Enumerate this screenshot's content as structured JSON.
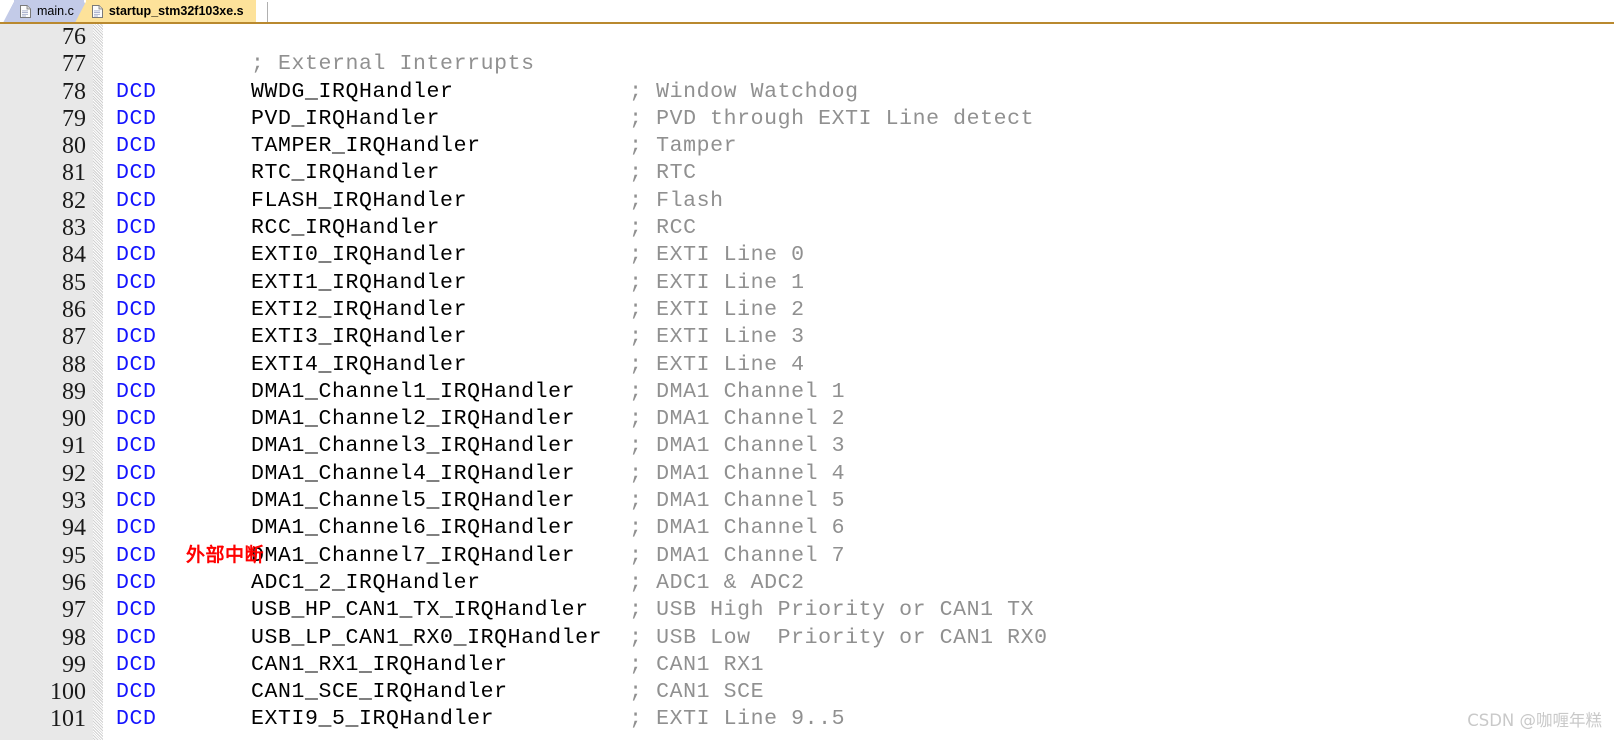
{
  "tabs": [
    {
      "label": "main.c",
      "active": false,
      "icon": "file-icon"
    },
    {
      "label": "startup_stm32f103xe.s",
      "active": true,
      "icon": "file-icon"
    }
  ],
  "editor": {
    "first_line_number": 76,
    "annotation": {
      "text": "外部中断",
      "color": "#ff0000",
      "near_line": 94
    },
    "colors": {
      "keyword": "#1414ff",
      "comment": "#909090",
      "text": "#000000",
      "gutter_background": "#e8e8e8",
      "active_tab": "#fde29a",
      "inactive_tab": "#c3cbe8"
    },
    "lines": [
      {
        "n": "76",
        "kw": "",
        "name": "",
        "cmt": ""
      },
      {
        "n": "77",
        "kw": "",
        "name": "",
        "cmt": "; External Interrupts"
      },
      {
        "n": "78",
        "kw": "DCD",
        "name": "WWDG_IRQHandler",
        "cmt": "; Window Watchdog"
      },
      {
        "n": "79",
        "kw": "DCD",
        "name": "PVD_IRQHandler",
        "cmt": "; PVD through EXTI Line detect"
      },
      {
        "n": "80",
        "kw": "DCD",
        "name": "TAMPER_IRQHandler",
        "cmt": "; Tamper"
      },
      {
        "n": "81",
        "kw": "DCD",
        "name": "RTC_IRQHandler",
        "cmt": "; RTC"
      },
      {
        "n": "82",
        "kw": "DCD",
        "name": "FLASH_IRQHandler",
        "cmt": "; Flash"
      },
      {
        "n": "83",
        "kw": "DCD",
        "name": "RCC_IRQHandler",
        "cmt": "; RCC"
      },
      {
        "n": "84",
        "kw": "DCD",
        "name": "EXTI0_IRQHandler",
        "cmt": "; EXTI Line 0"
      },
      {
        "n": "85",
        "kw": "DCD",
        "name": "EXTI1_IRQHandler",
        "cmt": "; EXTI Line 1"
      },
      {
        "n": "86",
        "kw": "DCD",
        "name": "EXTI2_IRQHandler",
        "cmt": "; EXTI Line 2"
      },
      {
        "n": "87",
        "kw": "DCD",
        "name": "EXTI3_IRQHandler",
        "cmt": "; EXTI Line 3"
      },
      {
        "n": "88",
        "kw": "DCD",
        "name": "EXTI4_IRQHandler",
        "cmt": "; EXTI Line 4"
      },
      {
        "n": "89",
        "kw": "DCD",
        "name": "DMA1_Channel1_IRQHandler",
        "cmt": "; DMA1 Channel 1"
      },
      {
        "n": "90",
        "kw": "DCD",
        "name": "DMA1_Channel2_IRQHandler",
        "cmt": "; DMA1 Channel 2"
      },
      {
        "n": "91",
        "kw": "DCD",
        "name": "DMA1_Channel3_IRQHandler",
        "cmt": "; DMA1 Channel 3"
      },
      {
        "n": "92",
        "kw": "DCD",
        "name": "DMA1_Channel4_IRQHandler",
        "cmt": "; DMA1 Channel 4"
      },
      {
        "n": "93",
        "kw": "DCD",
        "name": "DMA1_Channel5_IRQHandler",
        "cmt": "; DMA1 Channel 5"
      },
      {
        "n": "94",
        "kw": "DCD",
        "name": "DMA1_Channel6_IRQHandler",
        "cmt": "; DMA1 Channel 6"
      },
      {
        "n": "95",
        "kw": "DCD",
        "name": "DMA1_Channel7_IRQHandler",
        "cmt": "; DMA1 Channel 7"
      },
      {
        "n": "96",
        "kw": "DCD",
        "name": "ADC1_2_IRQHandler",
        "cmt": "; ADC1 & ADC2"
      },
      {
        "n": "97",
        "kw": "DCD",
        "name": "USB_HP_CAN1_TX_IRQHandler",
        "cmt": "; USB High Priority or CAN1 TX"
      },
      {
        "n": "98",
        "kw": "DCD",
        "name": "USB_LP_CAN1_RX0_IRQHandler",
        "cmt": "; USB Low  Priority or CAN1 RX0"
      },
      {
        "n": "99",
        "kw": "DCD",
        "name": "CAN1_RX1_IRQHandler",
        "cmt": "; CAN1 RX1"
      },
      {
        "n": "100",
        "kw": "DCD",
        "name": "CAN1_SCE_IRQHandler",
        "cmt": "; CAN1 SCE"
      },
      {
        "n": "101",
        "kw": "DCD",
        "name": "EXTI9_5_IRQHandler",
        "cmt": "; EXTI Line 9..5"
      }
    ]
  },
  "watermark": {
    "text": "CSDN @咖喱年糕"
  }
}
